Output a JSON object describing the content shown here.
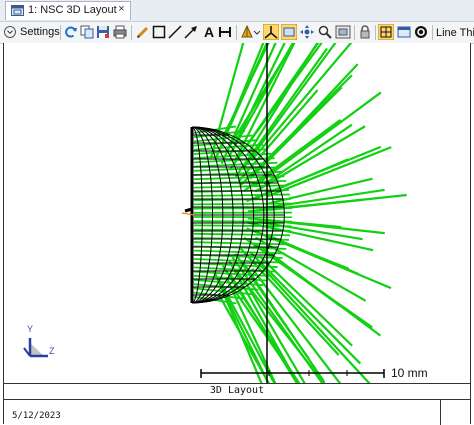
{
  "tab": {
    "label": "1: NSC 3D Layout",
    "close": "×"
  },
  "toolbar": {
    "settings_label": "Settings",
    "overflow_label": "Line Thic",
    "tools": [
      "refresh-icon",
      "copy-icon",
      "save-icon",
      "print-icon",
      "pencil-icon",
      "rectangle-icon",
      "line-icon",
      "arrow-icon",
      "text-icon",
      "dimension-icon",
      "rotate-icon",
      "axes-icon",
      "fit-icon",
      "pan-icon",
      "zoom-icon",
      "image-icon",
      "lock-icon",
      "grid-icon",
      "window-icon",
      "help-icon"
    ]
  },
  "plot": {
    "scale_bar_label": "10 mm",
    "axis_y": "Y",
    "axis_z": "Z",
    "colors": {
      "rays": "#12d012",
      "lens": "#000000",
      "source": "#ff7f00"
    }
  },
  "footer": {
    "title": "3D Layout",
    "date": "5/12/2023"
  }
}
